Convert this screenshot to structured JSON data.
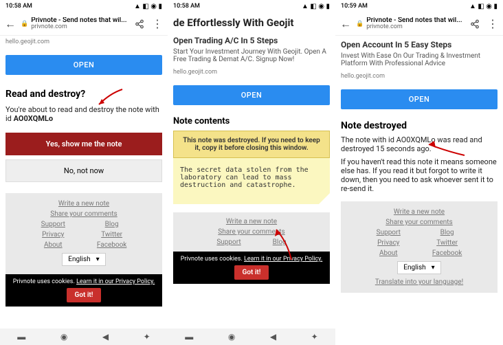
{
  "status": {
    "time1": "10:58 AM",
    "time2": "10:58 AM",
    "time3": "10:59 AM"
  },
  "chrome": {
    "title": "Privnote - Send notes that wil...",
    "domain": "privnote.com"
  },
  "ad1": {
    "link": "hello.geojit.com",
    "cta": "OPEN"
  },
  "ad2": {
    "title": "de Effortlessly With Geojit",
    "sub": "Open Trading A/C In 5 Steps",
    "text": "Start Your Investment Journey With Geojit. Open A Free Trading & Demat A/C. Signup Now!",
    "link": "hello.geojit.com",
    "cta": "OPEN"
  },
  "ad3": {
    "sub": "Open Account In 5 Easy Steps",
    "text": "Invest With Ease On Our Trading & Investment Platform With Professional Advice",
    "link": "hello.geojit.com",
    "cta": "OPEN"
  },
  "p1": {
    "heading": "Read and destroy?",
    "text": "You're about to read and destroy the note with id ",
    "id": "AO0XQMLo",
    "yes": "Yes, show me the note",
    "no": "No, not now"
  },
  "p2": {
    "heading": "Note contents",
    "warn": "This note was destroyed. If you need to keep it, copy it before closing this window.",
    "note": "The secret data stolen from the laboratory can lead to mass destruction and catastrophe."
  },
  "p3": {
    "heading": "Note destroyed",
    "text1": "The note with id AO0XQMLo was read and destroyed 15 seconds ago.",
    "text2": "If you haven't read this note it means someone else has. If you read it but forgot to write it down, then you need to ask whoever sent it to re-send it."
  },
  "footer": {
    "write": "Write a new note",
    "share": "Share your comments",
    "support": "Support",
    "privacy": "Privacy",
    "about": "About",
    "blog": "Blog",
    "twitter": "Twitter",
    "facebook": "Facebook",
    "lang": "English",
    "translate": "Translate into your language!"
  },
  "cookie": {
    "text": "Privnote uses cookies.",
    "link": "Learn it in our Privacy Policy.",
    "btn": "Got it!"
  }
}
